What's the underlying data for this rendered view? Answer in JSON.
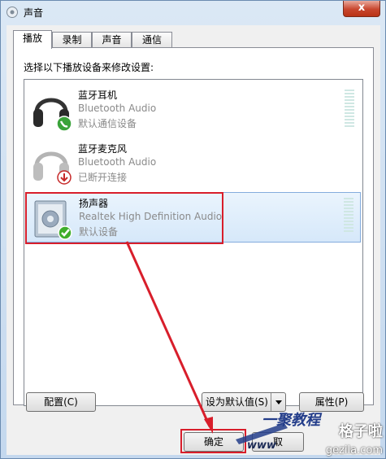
{
  "window": {
    "title": "声音",
    "close_label": "x"
  },
  "tabs": [
    {
      "label": "播放",
      "active": true
    },
    {
      "label": "录制",
      "active": false
    },
    {
      "label": "声音",
      "active": false
    },
    {
      "label": "通信",
      "active": false
    }
  ],
  "instruction": "选择以下播放设备来修改设置:",
  "devices": [
    {
      "name": "蓝牙耳机",
      "driver": "Bluetooth Audio",
      "status": "默认通信设备",
      "icon": "headphones-icon",
      "badge": "phone-badge-icon"
    },
    {
      "name": "蓝牙麦克风",
      "driver": "Bluetooth Audio",
      "status": "已断开连接",
      "icon": "headphones-icon",
      "badge": "disconnected-badge-icon"
    },
    {
      "name": "扬声器",
      "driver": "Realtek High Definition Audio",
      "status": "默认设备",
      "icon": "speaker-icon",
      "badge": "check-badge-icon",
      "selected": true
    }
  ],
  "buttons": {
    "configure": "配置(C)",
    "set_default": "设为默认值(S)",
    "properties": "属性(P)",
    "ok": "确定",
    "cancel": "取"
  },
  "watermark": {
    "logo_text": "一聚教程",
    "site_name": "格子啦",
    "domain": "gezila.com",
    "www": "www"
  },
  "colors": {
    "highlight_red": "#d81e2b",
    "selection_blue": "#d6e8fa"
  }
}
